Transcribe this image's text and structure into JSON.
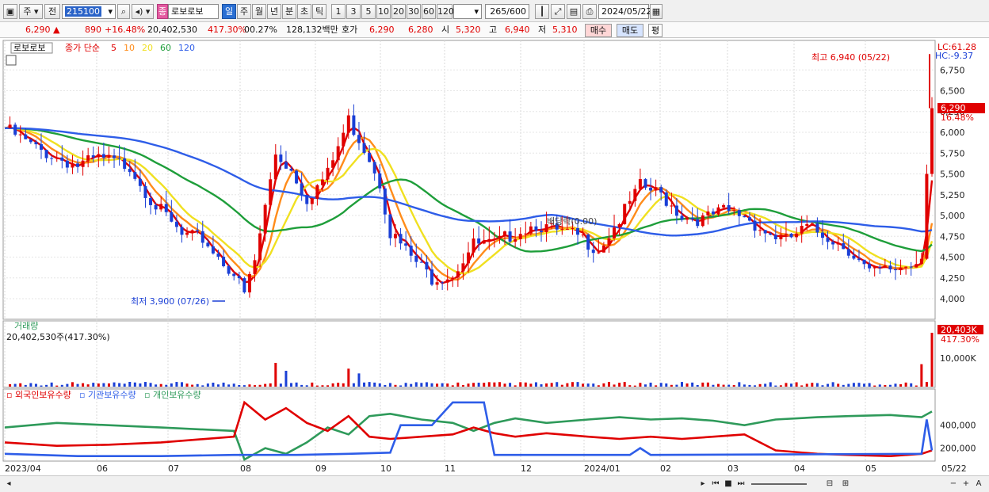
{
  "toolbar": {
    "period_type": "주",
    "prev_label": "전",
    "code": "215100",
    "stock_name": "로보로보",
    "stock_badge": "종",
    "periods": [
      "일",
      "주",
      "월",
      "년",
      "분",
      "초",
      "틱"
    ],
    "active_period": "일",
    "intervals": [
      "1",
      "3",
      "5",
      "10",
      "20",
      "30",
      "60",
      "120"
    ],
    "count": "265",
    "count_total": "/600",
    "date": "2024/05/22"
  },
  "quote": {
    "price": "6,290",
    "change_arrow": "▲",
    "change": "890",
    "change_pct": "+16.48%",
    "volume": "20,402,530",
    "volume_ratio": "417.30%",
    "turnover": "00.27%",
    "trade_amount": "128,132백만",
    "bid_label": "호가",
    "ask_price": "6,290",
    "bid_price": "6,280",
    "open_label": "시",
    "open": "5,320",
    "high_label": "고",
    "high": "6,940",
    "low_label": "저",
    "low": "5,310",
    "buy_label": "매수",
    "sell_label": "매도",
    "even_label": "평"
  },
  "legend": {
    "name": "로보로보",
    "ma_prefix": "종가 단순",
    "ma": [
      {
        "period": "5",
        "color": "#e00000"
      },
      {
        "period": "10",
        "color": "#ff8c1a"
      },
      {
        "period": "20",
        "color": "#f0e020"
      },
      {
        "period": "60",
        "color": "#1e9e3a"
      },
      {
        "period": "120",
        "color": "#2e5de8"
      }
    ]
  },
  "right_info": {
    "lc": "LC:61.28",
    "hc": "HC:-9.37",
    "last_price": "6,290",
    "last_pct": "16.48%"
  },
  "annotations": {
    "max_label": "최고 6,940 (05/22)",
    "min_label": "최저 3,900 (07/26)",
    "event_label": "배당락(0.00)"
  },
  "volume_panel": {
    "title": "거래량",
    "value_label": "20,402,530주(417.30%)",
    "last_value": "20,403K",
    "last_pct": "417.30%",
    "tick_label": "10,000K"
  },
  "holding_panel": {
    "series_names": [
      "외국인보유수량",
      "기관보유수량",
      "개인보유수량"
    ],
    "series_colors": [
      "#e00000",
      "#2e5de8",
      "#2e9a5a"
    ],
    "ticks": [
      "400,000",
      "200,000"
    ]
  },
  "chart_data": {
    "type": "candlestick",
    "months": [
      "2023/04",
      "06",
      "07",
      "08",
      "09",
      "10",
      "11",
      "12",
      "2024/01",
      "02",
      "03",
      "04",
      "05"
    ],
    "last_date_label": "05/22",
    "price_ticks": [
      6750,
      6500,
      6250,
      6000,
      5750,
      5500,
      5250,
      5000,
      4750,
      4500,
      4250,
      4000
    ],
    "price_range": [
      3800,
      7000
    ],
    "price_path": [
      [
        0,
        6050
      ],
      [
        6,
        5800
      ],
      [
        10,
        5700
      ],
      [
        14,
        5600
      ],
      [
        18,
        5680
      ],
      [
        24,
        5600
      ],
      [
        28,
        5200
      ],
      [
        34,
        4750
      ],
      [
        38,
        4720
      ],
      [
        44,
        4300
      ],
      [
        46,
        4050
      ],
      [
        48,
        4450
      ],
      [
        52,
        5750
      ],
      [
        55,
        5550
      ],
      [
        58,
        5200
      ],
      [
        62,
        5500
      ],
      [
        66,
        6150
      ],
      [
        70,
        5700
      ],
      [
        72,
        5400
      ],
      [
        74,
        4800
      ],
      [
        78,
        4500
      ],
      [
        82,
        4250
      ],
      [
        86,
        4300
      ],
      [
        90,
        4650
      ],
      [
        94,
        4650
      ],
      [
        98,
        4800
      ],
      [
        102,
        4900
      ],
      [
        106,
        4800
      ],
      [
        110,
        4750
      ],
      [
        114,
        4600
      ],
      [
        118,
        4950
      ],
      [
        122,
        5350
      ],
      [
        126,
        5250
      ],
      [
        130,
        5000
      ],
      [
        134,
        4950
      ],
      [
        138,
        5050
      ],
      [
        142,
        5000
      ],
      [
        146,
        4800
      ],
      [
        150,
        4700
      ],
      [
        154,
        4850
      ],
      [
        158,
        4750
      ],
      [
        162,
        4600
      ],
      [
        166,
        4300
      ],
      [
        170,
        4350
      ],
      [
        174,
        4420
      ],
      [
        176,
        4480
      ],
      [
        177,
        5500
      ],
      [
        178,
        6290
      ]
    ],
    "volume_spikes": [
      [
        52,
        9000
      ],
      [
        54,
        6000
      ],
      [
        66,
        6800
      ],
      [
        68,
        5000
      ],
      [
        176,
        8500
      ],
      [
        178,
        20400
      ]
    ],
    "holdings": {
      "foreign": [
        [
          0,
          250000
        ],
        [
          10,
          220000
        ],
        [
          20,
          230000
        ],
        [
          30,
          250000
        ],
        [
          44,
          300000
        ],
        [
          46,
          600000
        ],
        [
          50,
          450000
        ],
        [
          54,
          550000
        ],
        [
          58,
          420000
        ],
        [
          62,
          350000
        ],
        [
          66,
          480000
        ],
        [
          70,
          300000
        ],
        [
          74,
          280000
        ],
        [
          80,
          300000
        ],
        [
          86,
          320000
        ],
        [
          90,
          380000
        ],
        [
          94,
          330000
        ],
        [
          98,
          300000
        ],
        [
          104,
          330000
        ],
        [
          112,
          300000
        ],
        [
          118,
          280000
        ],
        [
          124,
          300000
        ],
        [
          130,
          280000
        ],
        [
          136,
          300000
        ],
        [
          142,
          320000
        ],
        [
          148,
          180000
        ],
        [
          156,
          150000
        ],
        [
          162,
          140000
        ],
        [
          170,
          130000
        ],
        [
          176,
          150000
        ],
        [
          178,
          180000
        ]
      ],
      "institution": [
        [
          0,
          150000
        ],
        [
          14,
          130000
        ],
        [
          30,
          130000
        ],
        [
          44,
          140000
        ],
        [
          56,
          140000
        ],
        [
          66,
          150000
        ],
        [
          74,
          160000
        ],
        [
          76,
          400000
        ],
        [
          82,
          400000
        ],
        [
          86,
          600000
        ],
        [
          92,
          600000
        ],
        [
          94,
          140000
        ],
        [
          120,
          140000
        ],
        [
          122,
          200000
        ],
        [
          124,
          140000
        ],
        [
          176,
          150000
        ],
        [
          177,
          450000
        ],
        [
          178,
          180000
        ]
      ],
      "individual": [
        [
          0,
          380000
        ],
        [
          10,
          420000
        ],
        [
          20,
          400000
        ],
        [
          30,
          380000
        ],
        [
          44,
          350000
        ],
        [
          46,
          100000
        ],
        [
          50,
          200000
        ],
        [
          54,
          150000
        ],
        [
          58,
          250000
        ],
        [
          62,
          380000
        ],
        [
          66,
          320000
        ],
        [
          70,
          480000
        ],
        [
          74,
          500000
        ],
        [
          80,
          450000
        ],
        [
          86,
          420000
        ],
        [
          90,
          350000
        ],
        [
          94,
          420000
        ],
        [
          98,
          460000
        ],
        [
          104,
          420000
        ],
        [
          112,
          450000
        ],
        [
          118,
          470000
        ],
        [
          124,
          450000
        ],
        [
          130,
          460000
        ],
        [
          136,
          440000
        ],
        [
          142,
          400000
        ],
        [
          148,
          450000
        ],
        [
          156,
          470000
        ],
        [
          162,
          480000
        ],
        [
          170,
          490000
        ],
        [
          176,
          470000
        ],
        [
          178,
          520000
        ]
      ]
    }
  }
}
